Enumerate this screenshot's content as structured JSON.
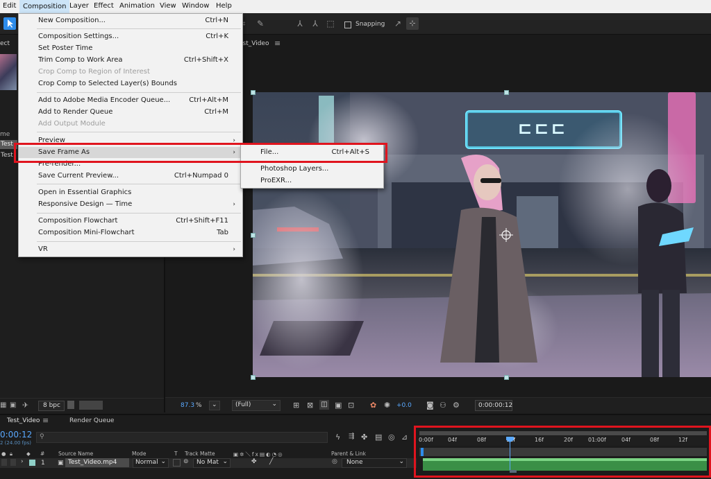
{
  "menubar": {
    "items": [
      {
        "label": "Edit"
      },
      {
        "label": "Composition"
      },
      {
        "label": "Layer"
      },
      {
        "label": "Effect"
      },
      {
        "label": "Animation"
      },
      {
        "label": "View"
      },
      {
        "label": "Window"
      },
      {
        "label": "Help"
      }
    ]
  },
  "toolbar": {
    "snapping_label": "Snapping"
  },
  "project_panel": {
    "tab_label": "ect",
    "name_col": "me",
    "item1": "Test",
    "item2": "Test",
    "bpc_label": "8 bpc"
  },
  "composition_tab": {
    "label": "est_Video"
  },
  "composition_menu": {
    "items": [
      {
        "label": "New Composition...",
        "shortcut": "Ctrl+N"
      },
      {
        "label": "Composition Settings...",
        "shortcut": "Ctrl+K"
      },
      {
        "label": "Set Poster Time",
        "shortcut": ""
      },
      {
        "label": "Trim Comp to Work Area",
        "shortcut": "Ctrl+Shift+X"
      },
      {
        "label": "Crop Comp to Region of Interest",
        "shortcut": ""
      },
      {
        "label": "Crop Comp to Selected Layer(s) Bounds",
        "shortcut": ""
      },
      {
        "label": "Add to Adobe Media Encoder Queue...",
        "shortcut": "Ctrl+Alt+M"
      },
      {
        "label": "Add to Render Queue",
        "shortcut": "Ctrl+M"
      },
      {
        "label": "Add Output Module",
        "shortcut": ""
      },
      {
        "label": "Preview",
        "shortcut": ""
      },
      {
        "label": "Save Frame As",
        "shortcut": ""
      },
      {
        "label": "Pre-render...",
        "shortcut": ""
      },
      {
        "label": "Save Current Preview...",
        "shortcut": "Ctrl+Numpad 0"
      },
      {
        "label": "Open in Essential Graphics",
        "shortcut": ""
      },
      {
        "label": "Responsive Design — Time",
        "shortcut": ""
      },
      {
        "label": "Composition Flowchart",
        "shortcut": "Ctrl+Shift+F11"
      },
      {
        "label": "Composition Mini-Flowchart",
        "shortcut": "Tab"
      },
      {
        "label": "VR",
        "shortcut": ""
      }
    ]
  },
  "save_frame_submenu": {
    "items": [
      {
        "label": "File...",
        "shortcut": "Ctrl+Alt+S"
      },
      {
        "label": "Photoshop Layers...",
        "shortcut": ""
      },
      {
        "label": "ProEXR...",
        "shortcut": ""
      }
    ]
  },
  "viewer": {
    "sign_text": "ㄷㄷㄷ",
    "zoom": "87.3",
    "zoom_unit": "%",
    "resolution": "(Full)",
    "exposure": "+0.0",
    "timecode": "0:00:00:12"
  },
  "timeline": {
    "tab_label": "Test_Video",
    "render_queue_label": "Render Queue",
    "timecode": "0:00:12",
    "fps": "2 (24.00 fps)",
    "search_placeholder": "",
    "col_number": "#",
    "col_source_name": "Source Name",
    "col_mode": "Mode",
    "col_t": "T",
    "col_track_matte": "Track Matte",
    "col_parent": "Parent & Link",
    "layer_number": "1",
    "layer_name": "Test_Video.mp4",
    "layer_mode": "Normal",
    "layer_matte": "No Mat",
    "layer_parent": "None",
    "ruler_ticks": [
      "0:00f",
      "04f",
      "08f",
      "12f",
      "16f",
      "20f",
      "01:00f",
      "04f",
      "08f",
      "12f"
    ]
  },
  "colors": {
    "highlight_red": "#e0141e",
    "accent_blue": "#2d8ceb",
    "layer_green": "#3fa34d"
  }
}
